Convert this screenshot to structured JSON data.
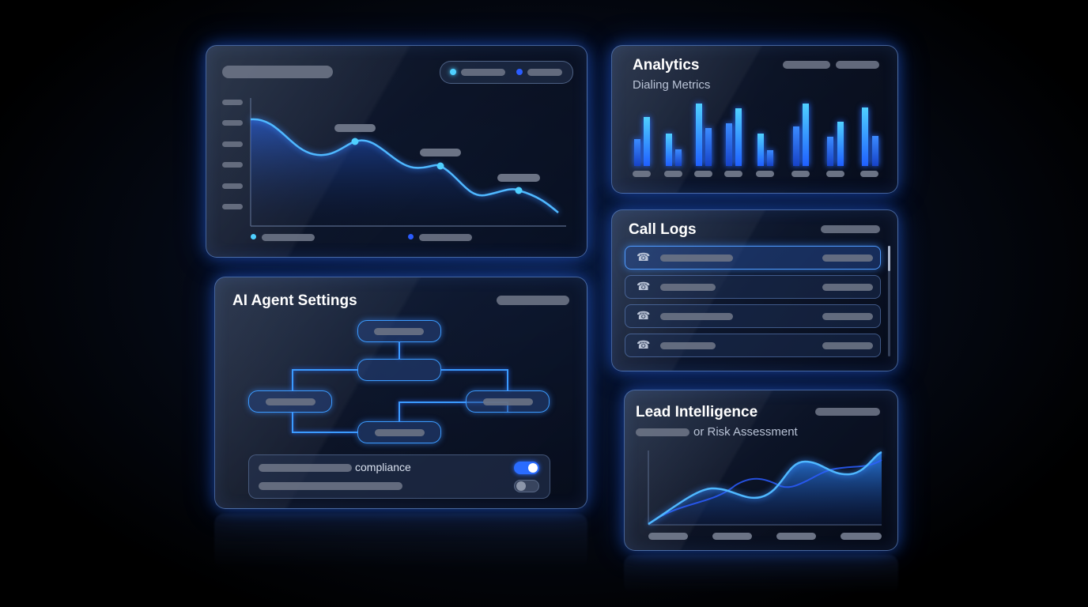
{
  "analytics": {
    "title": "Analytics",
    "subtitle": "Dialing Metrics"
  },
  "call_logs": {
    "title": "Call Logs",
    "rows": 4
  },
  "agent_settings": {
    "title": "AI Agent Settings",
    "compliance_label": "compliance",
    "toggle_1_on": true,
    "toggle_2_on": false
  },
  "lead_intel": {
    "title": "Lead Intelligence",
    "subtitle_suffix": "or Risk Assessment"
  },
  "colors": {
    "accent": "#3b8bff",
    "cyan": "#4fc3ff",
    "glow": "#2a6cff"
  },
  "icons": {
    "call": "phone-icon"
  }
}
